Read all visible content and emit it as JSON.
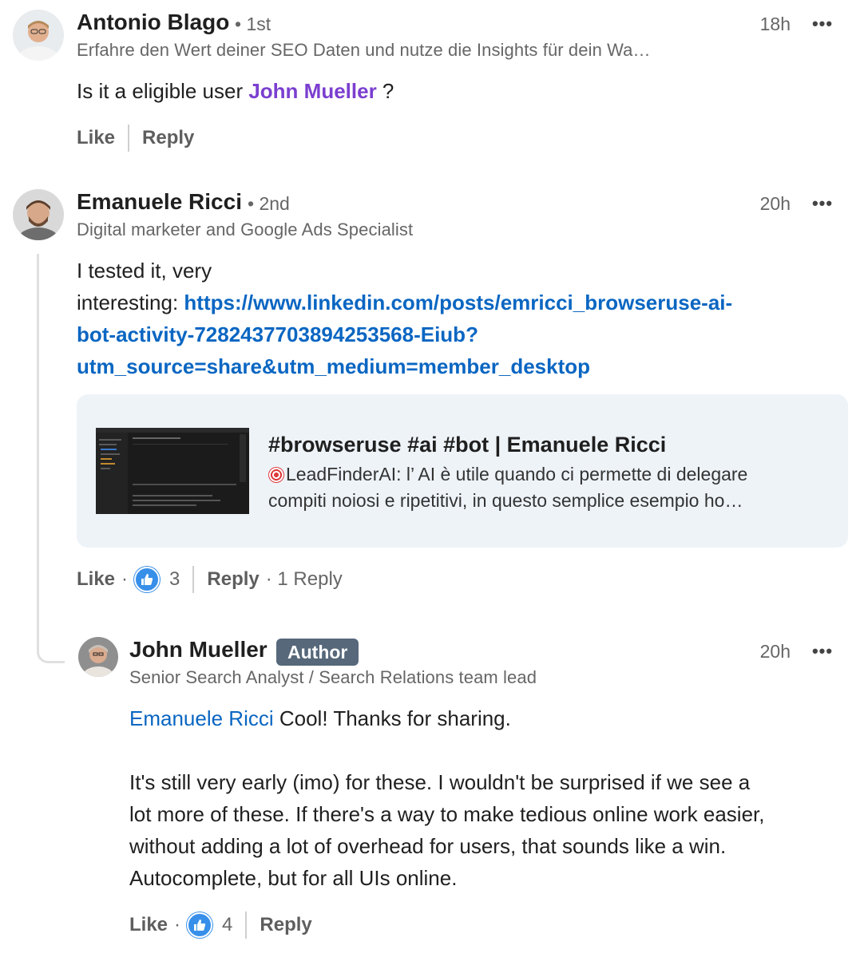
{
  "comment1": {
    "author": "Antonio Blago",
    "degree": "• 1st",
    "headline": "Erfahre den Wert deiner SEO Daten und nutze die Insights für dein Wa…",
    "time": "18h",
    "more_icon": "•••",
    "text_before": "Is it a eligible user ",
    "mention": "John Mueller",
    "text_after": " ?",
    "actions": {
      "like": "Like",
      "reply": "Reply"
    }
  },
  "comment2": {
    "author": "Emanuele Ricci",
    "degree": "• 2nd",
    "headline": "Digital marketer and Google Ads Specialist",
    "time": "20h",
    "more_icon": "•••",
    "text_line1": "I tested it, very",
    "text_line2_prefix": "interesting: ",
    "link_line1": "https://www.linkedin.com/posts/emricci_browseruse-ai-",
    "link_line2": "bot-activity-7282437703894253568-Eiub?",
    "link_line3": "utm_source=share&utm_medium=member_desktop",
    "preview": {
      "title": "#browseruse #ai #bot | Emanuele Ricci",
      "desc_line1": "LeadFinderAI: l’ AI è utile quando ci permette di delegare",
      "desc_line2": "compiti noiosi e ripetitivi, in questo semplice esempio ho…",
      "icon": "target-icon"
    },
    "actions": {
      "like": "Like",
      "like_sep": "·",
      "reaction_count": "3",
      "reply": "Reply",
      "reply_count": "· 1 Reply"
    }
  },
  "reply1": {
    "author": "John Mueller",
    "badge": "Author",
    "headline": "Senior Search Analyst / Search Relations team lead",
    "time": "20h",
    "more_icon": "•••",
    "mention": "Emanuele Ricci",
    "text_first": " Cool! Thanks for sharing.",
    "para_line1": "It's still very early (imo) for these. I wouldn't be surprised if we see a",
    "para_line2": "lot more of these. If there's a way to make tedious online work easier,",
    "para_line3": "without adding a lot of overhead for users, that sounds like a win.",
    "para_line4": "Autocomplete, but for all UIs online.",
    "actions": {
      "like": "Like",
      "like_sep": "·",
      "reaction_count": "4",
      "reply": "Reply"
    }
  },
  "colors": {
    "link": "#0a66c2",
    "mention_purple": "#7b3fcf",
    "like_blue": "#378fe9",
    "card_bg": "#eef3f8"
  }
}
